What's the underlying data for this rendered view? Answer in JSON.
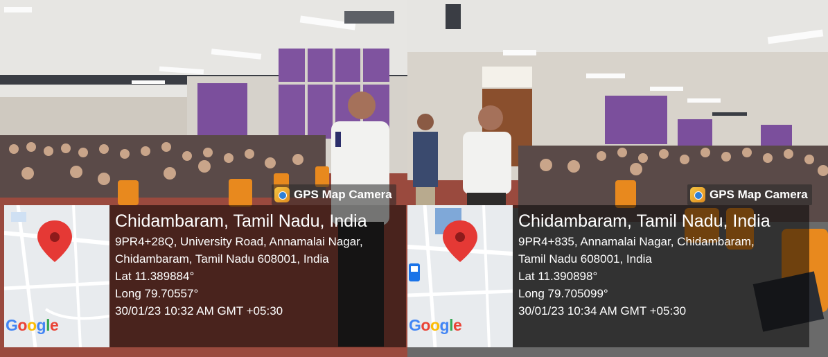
{
  "photos": [
    {
      "watermark": "GPS Map Camera",
      "map_provider": "Google",
      "location_title": "Chidambaram, Tamil Nadu, India",
      "address_line1": "9PR4+28Q, University Road, Annamalai Nagar,",
      "address_line2": "Chidambaram, Tamil Nadu 608001, India",
      "latitude": "Lat 11.389884°",
      "longitude": "Long 79.70557°",
      "timestamp": "30/01/23 10:32 AM GMT +05:30"
    },
    {
      "watermark": "GPS Map Camera",
      "map_provider": "Google",
      "location_title": "Chidambaram, Tamil Nadu, India",
      "address_line1": "9PR4+835, Annamalai Nagar, Chidambaram,",
      "address_line2": "Tamil Nadu 608001, India",
      "latitude": "Lat 11.390898°",
      "longitude": "Long 79.705099°",
      "timestamp": "30/01/23 10:34 AM GMT +05:30"
    }
  ],
  "colors": {
    "ceiling": "#e6e6e4",
    "wall": "#d7d3cc",
    "window_tint": "#7b4f9c",
    "chair": "#e8891e",
    "floor": "#a3443b",
    "map_pin": "#e53935",
    "overlay": "#000000"
  },
  "icons": [
    "map-pin-icon",
    "camera-app-icon",
    "bus-stop-icon"
  ]
}
